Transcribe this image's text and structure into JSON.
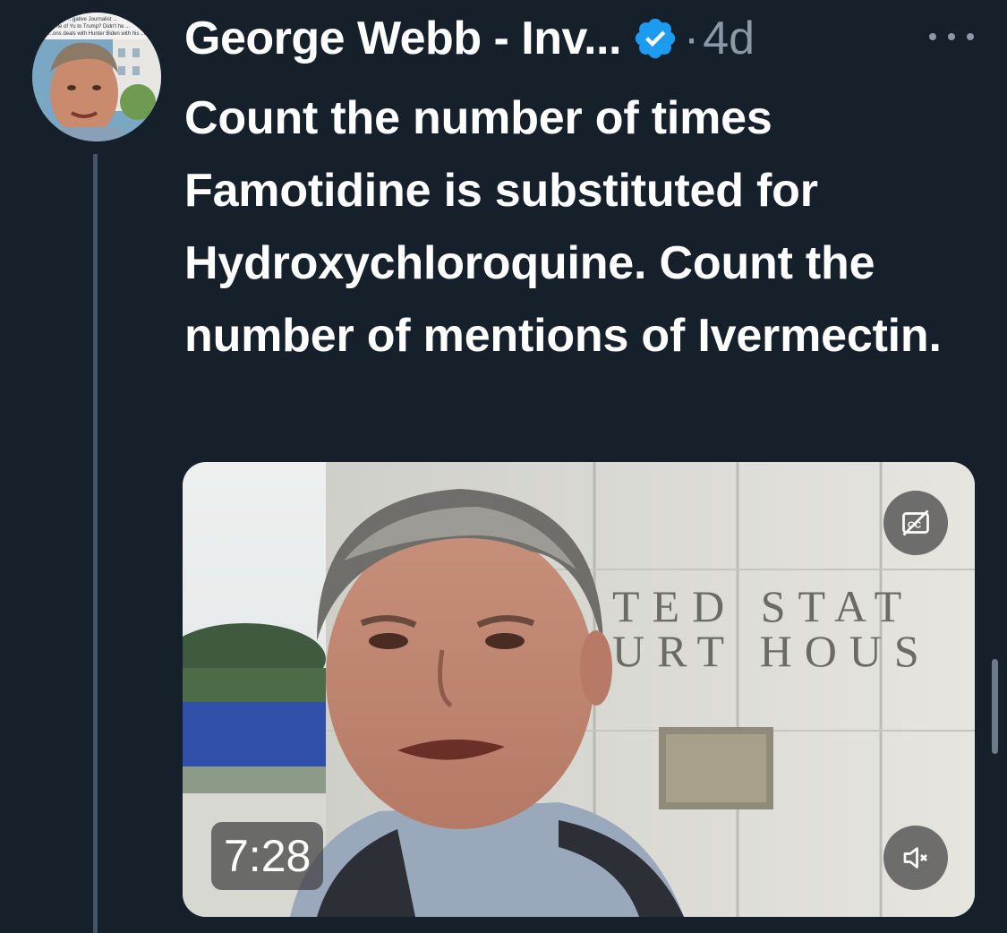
{
  "author": {
    "display_name": "George Webb - Inv...",
    "verified": true,
    "timestamp_separator": "·",
    "timestamp": "4d",
    "avatar_caption_lines": [
      "...gative Journalist ...",
      "...me of Yu to Trump? Didn't he ...",
      "...ons deals with Hunter Biden with his ..."
    ]
  },
  "tweet": {
    "text": "Count the number of times Famotidine is substituted for Hydroxychloroquine. Count the number of mentions of Ivermectin."
  },
  "media": {
    "type": "video",
    "duration": "7:28",
    "sign_line1": "TED STAT",
    "sign_line2": "URT HOUS"
  },
  "colors": {
    "background": "#15202b",
    "text_primary": "#ffffff",
    "text_secondary": "#8b98a5",
    "verified_badge": "#1d9bf0",
    "thread_line": "#425466"
  },
  "icons": {
    "verified": "verified-badge-icon",
    "more": "more-options-icon",
    "captions": "closed-captions-off-icon",
    "mute": "volume-muted-icon"
  }
}
